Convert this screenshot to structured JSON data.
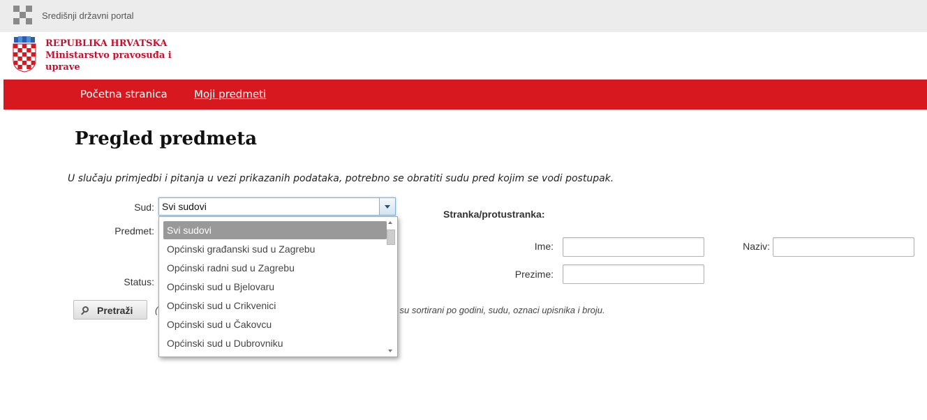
{
  "portal": {
    "name": "Središnji državni portal"
  },
  "brand": {
    "line1": "REPUBLIKA HRVATSKA",
    "line2": "Ministarstvo pravosuđa i",
    "line3": "uprave"
  },
  "nav": {
    "items": [
      {
        "label": "Početna stranica"
      },
      {
        "label": "Moji predmeti"
      }
    ]
  },
  "page": {
    "title": "Pregled predmeta",
    "notice": "U slučaju primjedbi i pitanja u vezi prikazanih podataka, potrebno se obratiti sudu pred kojim se vodi postupak."
  },
  "form": {
    "sud_label": "Sud:",
    "predmet_label": "Predmet:",
    "status_label": "Status:",
    "sud_value": "Svi sudovi",
    "stranka_heading": "Stranka/protustranka:",
    "ime_label": "Ime:",
    "prezime_label": "Prezime:",
    "naziv_label": "Naziv:",
    "ime_value": "",
    "prezime_value": "",
    "naziv_value": "",
    "search_label": "Pretraži",
    "hint_lead": "(",
    "hint": "i su sortirani po godini, sudu, oznaci upisnika i broju."
  },
  "dropdown": {
    "options": [
      "Svi sudovi",
      "Općinski građanski sud u Zagrebu",
      "Općinski radni sud u Zagrebu",
      "Općinski sud u Bjelovaru",
      "Općinski sud u Crikvenici",
      "Općinski sud u Čakovcu",
      "Općinski sud u Dubrovniku"
    ],
    "selected_index": 0
  },
  "colors": {
    "nav_bg": "#d7191f",
    "brand_red": "#c8102e",
    "portal_bg": "#ececec"
  }
}
